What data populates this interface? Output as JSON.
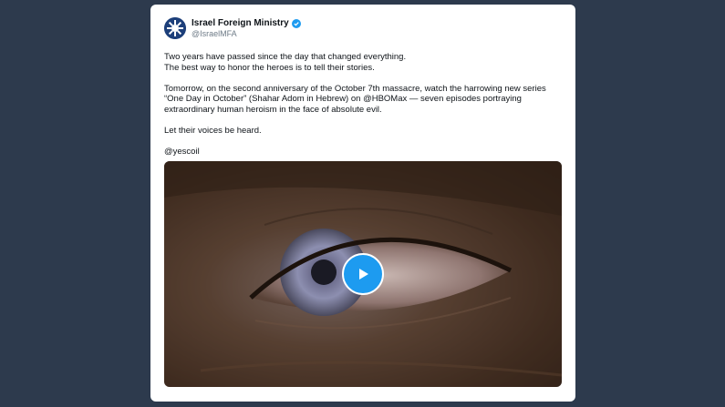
{
  "tweet": {
    "author_name": "Israel Foreign Ministry",
    "author_handle": "@IsraelMFA",
    "paragraphs": [
      "Two years have passed since the day that changed everything.",
      "The best way to honor the heroes is to tell their stories.",
      "Tomorrow, on the second anniversary of the October 7th massacre, watch the harrowing new series",
      "“One Day in October” (Shahar Adom in Hebrew) on @HBOMax — seven episodes portraying",
      "extraordinary human heroism in the face of absolute evil.",
      "Let their voices be heard.",
      "@yescoil"
    ],
    "media": {
      "type": "video",
      "play_icon": "play-icon"
    }
  },
  "colors": {
    "background": "#2d3a4d",
    "card": "#ffffff",
    "accent": "#1d9bf0"
  }
}
